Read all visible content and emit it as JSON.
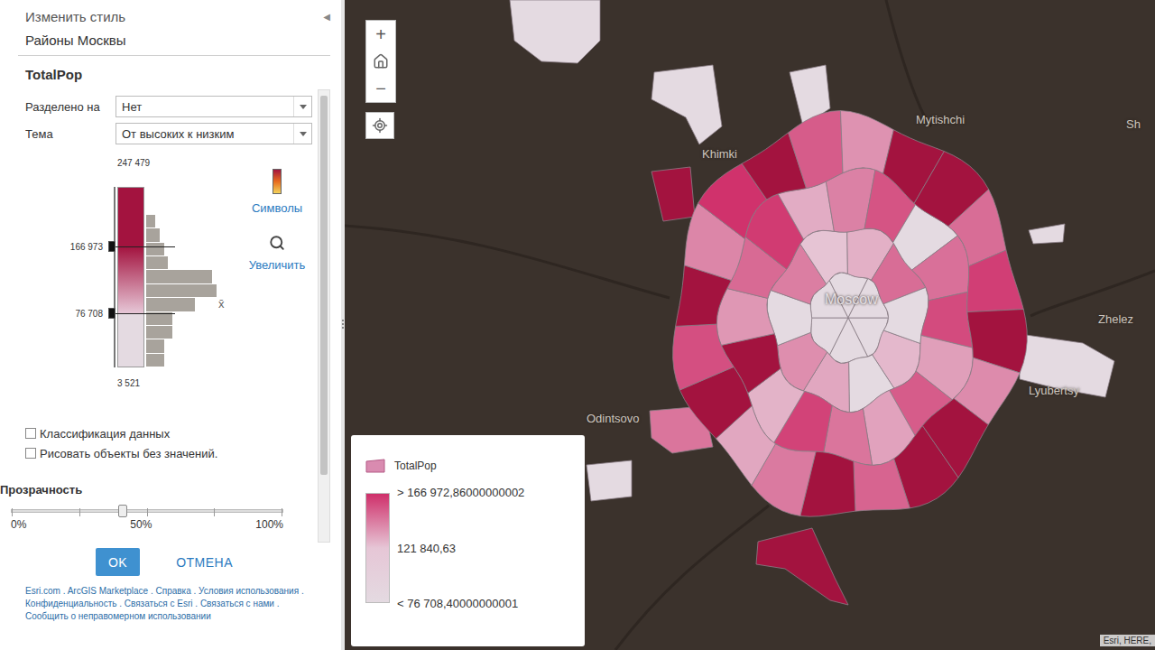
{
  "panel": {
    "title": "Изменить стиль",
    "collapse_glyph": "◀",
    "layer": "Районы Москвы",
    "field": "TotalPop",
    "fields": [
      {
        "label": "Разделено на",
        "value": "Нет"
      },
      {
        "label": "Тема",
        "value": "От высоких к низким"
      }
    ],
    "histogram": {
      "max": "247 479",
      "min": "3 521",
      "mean_label": "x̄",
      "mean_level": 0.355,
      "handles": [
        {
          "label": "166 973",
          "level": 0.67
        },
        {
          "label": "76 708",
          "level": 0.3
        }
      ],
      "counts": [
        0,
        0,
        2,
        3,
        4,
        5,
        15,
        16,
        11,
        6,
        6,
        4,
        4
      ]
    },
    "tools": [
      {
        "label": "Символы"
      },
      {
        "label": "Увеличить"
      }
    ],
    "options": [
      {
        "label": "Классификация данных",
        "checked": false
      },
      {
        "label": "Рисовать объекты без значений.",
        "checked": false
      }
    ],
    "transparency": {
      "label": "Прозрачность",
      "level": 0.41,
      "ticks": [
        "0%",
        "50%",
        "100%"
      ]
    },
    "buttons": [
      {
        "label": "OK",
        "primary": true
      },
      {
        "label": "ОТМЕНА",
        "primary": false
      }
    ],
    "footer_separator": ".",
    "footer_links": [
      "Esri.com",
      "ArcGIS Marketplace",
      "Справка",
      "Условия использования",
      "Конфиденциальность",
      "Связаться с Esri",
      "Связаться с нами",
      "Сообщить о неправомерном использовании"
    ]
  },
  "map": {
    "zoom_in": "+",
    "zoom_out": "−",
    "labels": [
      {
        "text": "Mytishchi"
      },
      {
        "text": "Khimki"
      },
      {
        "text": "Moscow"
      },
      {
        "text": "Zhelez"
      },
      {
        "text": "Lyubertsy"
      },
      {
        "text": "Odintsovo"
      },
      {
        "text": "Sh"
      }
    ],
    "districts": {
      "rings": [
        [
          45000,
          60000,
          38000,
          52000,
          70000,
          41000
        ],
        [
          85000,
          72000,
          95000,
          110000,
          68000,
          120000,
          78000,
          90000,
          130000,
          74000
        ],
        [
          140000,
          98000,
          125000,
          155000,
          88000,
          170000,
          105000,
          132000,
          160000,
          92000,
          118000,
          145000,
          76000,
          128000,
          150000,
          100000
        ],
        [
          180000,
          135000,
          210000,
          122000,
          95000,
          190000,
          148000,
          230000,
          115000,
          165000,
          200000,
          140000,
          108000,
          175000,
          247479,
          130000,
          158000,
          220000,
          112000,
          185000
        ]
      ],
      "outer": [
        60000,
        50000,
        45000,
        205000,
        215000,
        70000,
        125000,
        35000,
        25000
      ]
    },
    "legend": {
      "title": "TotalPop",
      "high": "> 166 972,86000000002",
      "mid": "121 840,63",
      "low": "< 76 708,40000000001"
    },
    "attribution": "Esri, HERE,"
  }
}
